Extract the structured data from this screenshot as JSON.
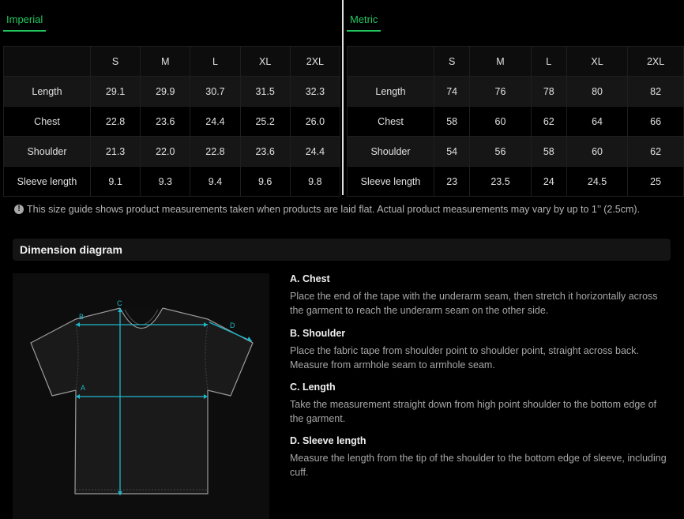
{
  "imperial": {
    "tab_label": "Imperial",
    "headers": [
      "",
      "S",
      "M",
      "L",
      "XL",
      "2XL"
    ],
    "rows": [
      {
        "label": "Length",
        "values": [
          "29.1",
          "29.9",
          "30.7",
          "31.5",
          "32.3"
        ]
      },
      {
        "label": "Chest",
        "values": [
          "22.8",
          "23.6",
          "24.4",
          "25.2",
          "26.0"
        ]
      },
      {
        "label": "Shoulder",
        "values": [
          "21.3",
          "22.0",
          "22.8",
          "23.6",
          "24.4"
        ]
      },
      {
        "label": "Sleeve length",
        "values": [
          "9.1",
          "9.3",
          "9.4",
          "9.6",
          "9.8"
        ]
      }
    ]
  },
  "metric": {
    "tab_label": "Metric",
    "headers": [
      "",
      "S",
      "M",
      "L",
      "XL",
      "2XL"
    ],
    "rows": [
      {
        "label": "Length",
        "values": [
          "74",
          "76",
          "78",
          "80",
          "82"
        ]
      },
      {
        "label": "Chest",
        "values": [
          "58",
          "60",
          "62",
          "64",
          "66"
        ]
      },
      {
        "label": "Shoulder",
        "values": [
          "54",
          "56",
          "58",
          "60",
          "62"
        ]
      },
      {
        "label": "Sleeve length",
        "values": [
          "23",
          "23.5",
          "24",
          "24.5",
          "25"
        ]
      }
    ]
  },
  "note": {
    "icon": "info-icon",
    "icon_glyph": "!",
    "text": "This size guide shows product measurements taken when products are laid flat. Actual product measurements may vary by up to 1’’ (2.5cm)."
  },
  "dimension": {
    "title": "Dimension diagram",
    "diagram_labels": {
      "a": "A",
      "b": "B",
      "c": "C",
      "d": "D"
    },
    "items": [
      {
        "title": "A. Chest",
        "text": "Place the end of the tape with the underarm seam, then stretch it horizontally across the garment to reach the underarm seam on the other side."
      },
      {
        "title": "B. Shoulder",
        "text": "Place the fabric tape from shoulder point to shoulder point, straight across back. Measure from armhole seam to armhole seam."
      },
      {
        "title": "C. Length",
        "text": "Take the measurement straight down from high point shoulder to the bottom edge of the garment."
      },
      {
        "title": "D. Sleeve length",
        "text": "Measure the length from the tip of the shoulder to the bottom edge of sleeve, including cuff."
      }
    ]
  },
  "colors": {
    "accent": "#22c55e",
    "measure": "#1fb6c9",
    "background": "#000000"
  }
}
